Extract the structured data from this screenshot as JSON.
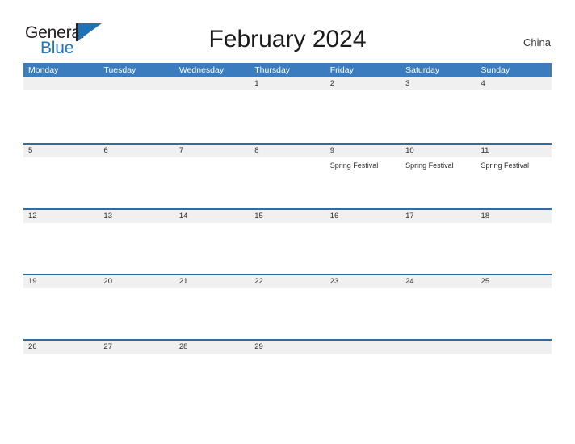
{
  "brand": {
    "name_part1": "General",
    "name_part2": "Blue",
    "mark_icon": "blue-triangle-flag-icon",
    "colors": {
      "text": "#231f20",
      "accent": "#2175bc"
    }
  },
  "header": {
    "title": "February 2024",
    "region": "China"
  },
  "calendar": {
    "colors": {
      "header_bar": "#3a7cbd",
      "row_divider": "#2e6da4",
      "date_band": "#f0f0f0"
    },
    "weekdays": [
      "Monday",
      "Tuesday",
      "Wednesday",
      "Thursday",
      "Friday",
      "Saturday",
      "Sunday"
    ],
    "weeks": [
      [
        {
          "date": "",
          "events": []
        },
        {
          "date": "",
          "events": []
        },
        {
          "date": "",
          "events": []
        },
        {
          "date": "1",
          "events": []
        },
        {
          "date": "2",
          "events": []
        },
        {
          "date": "3",
          "events": []
        },
        {
          "date": "4",
          "events": []
        }
      ],
      [
        {
          "date": "5",
          "events": []
        },
        {
          "date": "6",
          "events": []
        },
        {
          "date": "7",
          "events": []
        },
        {
          "date": "8",
          "events": []
        },
        {
          "date": "9",
          "events": [
            "Spring Festival"
          ]
        },
        {
          "date": "10",
          "events": [
            "Spring Festival"
          ]
        },
        {
          "date": "11",
          "events": [
            "Spring Festival"
          ]
        }
      ],
      [
        {
          "date": "12",
          "events": []
        },
        {
          "date": "13",
          "events": []
        },
        {
          "date": "14",
          "events": []
        },
        {
          "date": "15",
          "events": []
        },
        {
          "date": "16",
          "events": []
        },
        {
          "date": "17",
          "events": []
        },
        {
          "date": "18",
          "events": []
        }
      ],
      [
        {
          "date": "19",
          "events": []
        },
        {
          "date": "20",
          "events": []
        },
        {
          "date": "21",
          "events": []
        },
        {
          "date": "22",
          "events": []
        },
        {
          "date": "23",
          "events": []
        },
        {
          "date": "24",
          "events": []
        },
        {
          "date": "25",
          "events": []
        }
      ],
      [
        {
          "date": "26",
          "events": []
        },
        {
          "date": "27",
          "events": []
        },
        {
          "date": "28",
          "events": []
        },
        {
          "date": "29",
          "events": []
        },
        {
          "date": "",
          "events": []
        },
        {
          "date": "",
          "events": []
        },
        {
          "date": "",
          "events": []
        }
      ]
    ]
  }
}
